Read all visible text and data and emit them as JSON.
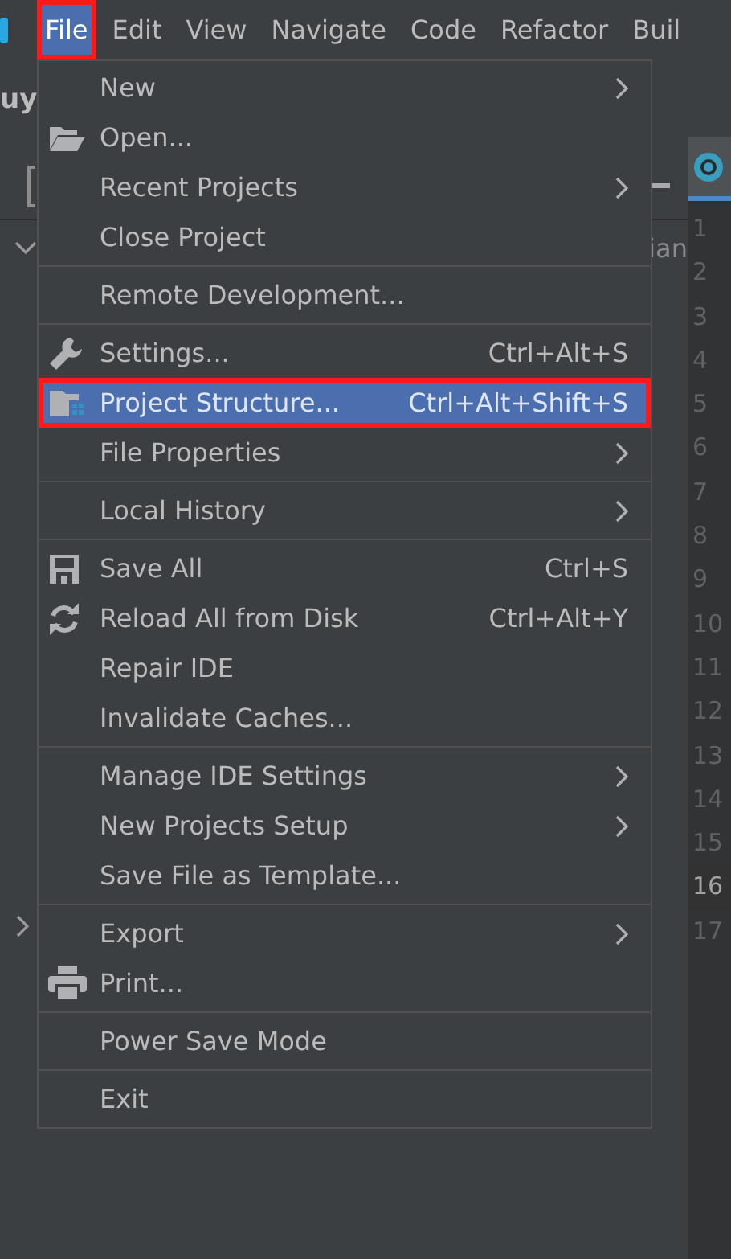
{
  "menu_bar": [
    {
      "label": "File",
      "selected": true,
      "highlighted": true
    },
    {
      "label": "Edit",
      "selected": false,
      "highlighted": false
    },
    {
      "label": "View",
      "selected": false,
      "highlighted": false
    },
    {
      "label": "Navigate",
      "selected": false,
      "highlighted": false
    },
    {
      "label": "Code",
      "selected": false,
      "highlighted": false
    },
    {
      "label": "Refactor",
      "selected": false,
      "highlighted": false
    },
    {
      "label": "Buil",
      "selected": false,
      "highlighted": false
    }
  ],
  "project_panel": {
    "title": "uy",
    "text_fragment": "ian"
  },
  "gutter": {
    "lines": [
      {
        "number": "1",
        "current": false
      },
      {
        "number": "2",
        "current": false
      },
      {
        "number": "3",
        "current": false
      },
      {
        "number": "4",
        "current": false
      },
      {
        "number": "5",
        "current": false
      },
      {
        "number": "6",
        "current": false
      },
      {
        "number": "7",
        "current": false
      },
      {
        "number": "8",
        "current": false
      },
      {
        "number": "9",
        "current": false
      },
      {
        "number": "10",
        "current": false
      },
      {
        "number": "11",
        "current": false
      },
      {
        "number": "12",
        "current": false
      },
      {
        "number": "13",
        "current": false
      },
      {
        "number": "14",
        "current": false
      },
      {
        "number": "15",
        "current": false
      },
      {
        "number": "16",
        "current": true
      },
      {
        "number": "17",
        "current": false
      }
    ]
  },
  "file_menu": [
    {
      "kind": "item",
      "label": "New",
      "submenu": true,
      "selected": false,
      "highlighted": false
    },
    {
      "kind": "item",
      "label": "Open...",
      "submenu": false,
      "selected": false,
      "highlighted": false
    },
    {
      "kind": "item",
      "label": "Recent Projects",
      "submenu": true,
      "selected": false,
      "highlighted": false
    },
    {
      "kind": "item",
      "label": "Close Project",
      "submenu": false,
      "selected": false,
      "highlighted": false
    },
    {
      "kind": "separator"
    },
    {
      "kind": "item",
      "label": "Remote Development...",
      "submenu": false,
      "selected": false,
      "highlighted": false
    },
    {
      "kind": "separator"
    },
    {
      "kind": "item",
      "label": "Settings...",
      "shortcut": "Ctrl+Alt+S",
      "submenu": false,
      "selected": false,
      "highlighted": false
    },
    {
      "kind": "item",
      "label": "Project Structure...",
      "shortcut": "Ctrl+Alt+Shift+S",
      "submenu": false,
      "selected": true,
      "highlighted": true
    },
    {
      "kind": "item",
      "label": "File Properties",
      "submenu": true,
      "selected": false,
      "highlighted": false
    },
    {
      "kind": "separator"
    },
    {
      "kind": "item",
      "label": "Local History",
      "submenu": true,
      "selected": false,
      "highlighted": false
    },
    {
      "kind": "separator"
    },
    {
      "kind": "item",
      "label": "Save All",
      "shortcut": "Ctrl+S",
      "submenu": false,
      "selected": false,
      "highlighted": false
    },
    {
      "kind": "item",
      "label": "Reload All from Disk",
      "shortcut": "Ctrl+Alt+Y",
      "submenu": false,
      "selected": false,
      "highlighted": false
    },
    {
      "kind": "item",
      "label": "Repair IDE",
      "submenu": false,
      "selected": false,
      "highlighted": false
    },
    {
      "kind": "item",
      "label": "Invalidate Caches...",
      "submenu": false,
      "selected": false,
      "highlighted": false
    },
    {
      "kind": "separator"
    },
    {
      "kind": "item",
      "label": "Manage IDE Settings",
      "submenu": true,
      "selected": false,
      "highlighted": false
    },
    {
      "kind": "item",
      "label": "New Projects Setup",
      "submenu": true,
      "selected": false,
      "highlighted": false
    },
    {
      "kind": "item",
      "label": "Save File as Template...",
      "submenu": false,
      "selected": false,
      "highlighted": false
    },
    {
      "kind": "separator"
    },
    {
      "kind": "item",
      "label": "Export",
      "submenu": true,
      "selected": false,
      "highlighted": false
    },
    {
      "kind": "item",
      "label": "Print...",
      "submenu": false,
      "selected": false,
      "highlighted": false
    },
    {
      "kind": "separator"
    },
    {
      "kind": "item",
      "label": "Power Save Mode",
      "submenu": false,
      "selected": false,
      "highlighted": false
    },
    {
      "kind": "separator"
    },
    {
      "kind": "item",
      "label": "Exit",
      "submenu": false,
      "selected": false,
      "highlighted": false
    }
  ]
}
